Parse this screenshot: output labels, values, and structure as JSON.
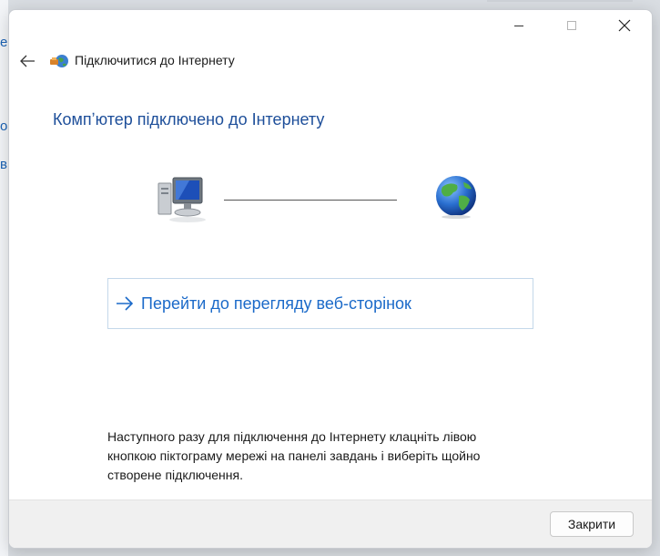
{
  "background_fragments": [
    "е",
    "о",
    "ві"
  ],
  "window": {
    "controls": {
      "minimize_icon": "minimize-icon",
      "maximize_icon": "maximize-icon",
      "close_icon": "close-icon"
    },
    "nav": {
      "back_icon": "back-arrow-icon",
      "wizard_icon": "network-wizard-icon",
      "title": "Підключитися до Інтернету"
    },
    "heading": "Компʼютер підключено до Інтернету",
    "diagram": {
      "left_icon": "computer-icon",
      "right_icon": "globe-icon"
    },
    "browse_link": {
      "icon": "arrow-right-icon",
      "label": "Перейти до перегляду веб-сторінок"
    },
    "hint": "Наступного разу для підключення до Інтернету клацніть лівою кнопкою піктограму мережі на панелі завдань і виберіть щойно створене підключення.",
    "footer": {
      "close_label": "Закрити"
    }
  },
  "colors": {
    "heading": "#1e4f9a",
    "link": "#1b6ac9",
    "link_border": "#c4d8ea",
    "footer_bg": "#f0f0f0"
  }
}
